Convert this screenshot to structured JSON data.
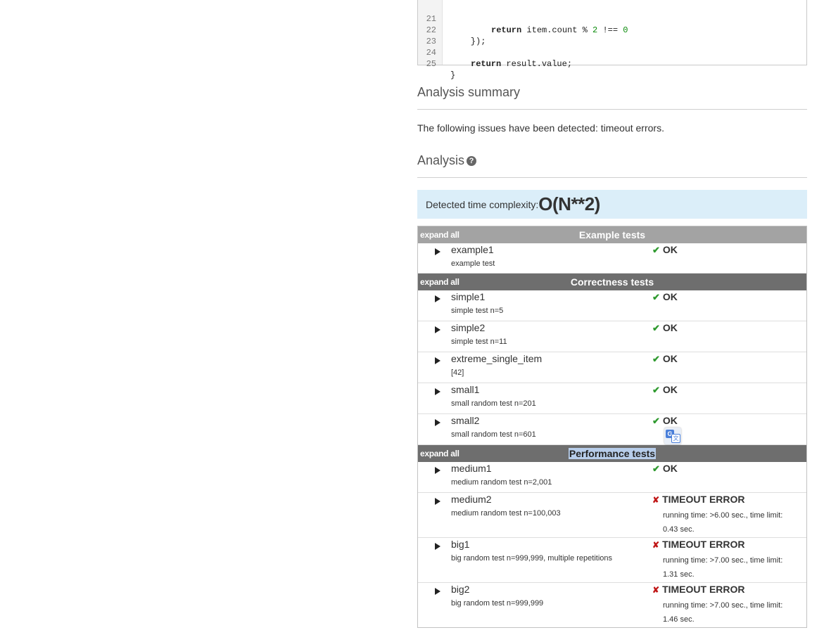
{
  "code": {
    "lines": [
      {
        "n": "21",
        "kw": "return",
        "rest": " item.count % ",
        "num1": "2",
        "rest2": " !== ",
        "num2": "0"
      },
      {
        "n": "22",
        "text": "    });"
      },
      {
        "n": "23",
        "text": ""
      },
      {
        "n": "24",
        "kw": "return",
        "rest": " result.value;"
      },
      {
        "n": "25",
        "text": "}"
      }
    ]
  },
  "summary": {
    "heading": "Analysis summary",
    "text": "The following issues have been detected: timeout errors."
  },
  "analysis": {
    "heading": "Analysis",
    "help_glyph": "?",
    "complexity_label": "Detected time complexity:",
    "complexity_value": "O(N**2)"
  },
  "groups": [
    {
      "expand_label": "expand all",
      "title": "Example tests",
      "tests": [
        {
          "name": "example1",
          "desc": "example test",
          "result": "OK",
          "ok": true
        }
      ]
    },
    {
      "expand_label": "expand all",
      "title": "Correctness tests",
      "tests": [
        {
          "name": "simple1",
          "desc": "simple test n=5",
          "result": "OK",
          "ok": true
        },
        {
          "name": "simple2",
          "desc": "simple test n=11",
          "result": "OK",
          "ok": true
        },
        {
          "name": "extreme_single_item",
          "desc": "[42]",
          "result": "OK",
          "ok": true
        },
        {
          "name": "small1",
          "desc": "small random test n=201",
          "result": "OK",
          "ok": true
        },
        {
          "name": "small2",
          "desc": "small random test n=601",
          "result": "OK",
          "ok": true
        }
      ]
    },
    {
      "expand_label": "expand all",
      "title": "Performance tests",
      "tests": [
        {
          "name": "medium1",
          "desc": "medium random test n=2,001",
          "result": "OK",
          "ok": true
        },
        {
          "name": "medium2",
          "desc": "medium random test n=100,003",
          "result": "TIMEOUT ERROR",
          "ok": false,
          "detail": "running time: >6.00 sec., time limit: 0.43 sec."
        },
        {
          "name": "big1",
          "desc": "big random test n=999,999, multiple repetitions",
          "result": "TIMEOUT ERROR",
          "ok": false,
          "detail": "running time: >7.00 sec., time limit: 1.31 sec."
        },
        {
          "name": "big2",
          "desc": "big random test n=999,999",
          "result": "TIMEOUT ERROR",
          "ok": false,
          "detail": "running time: >7.00 sec., time limit: 1.46 sec."
        }
      ]
    }
  ],
  "icons": {
    "ok": "check-icon",
    "fail": "cross-icon",
    "expand": "triangle-right-icon",
    "help": "question-icon",
    "translate": "google-translate-icon"
  },
  "colors": {
    "ok": "#2f9a2f",
    "fail": "#c01717",
    "complexity_bg": "#dbeef9",
    "group_example": "#a3a3a3",
    "group_other": "#6e6e6e"
  }
}
